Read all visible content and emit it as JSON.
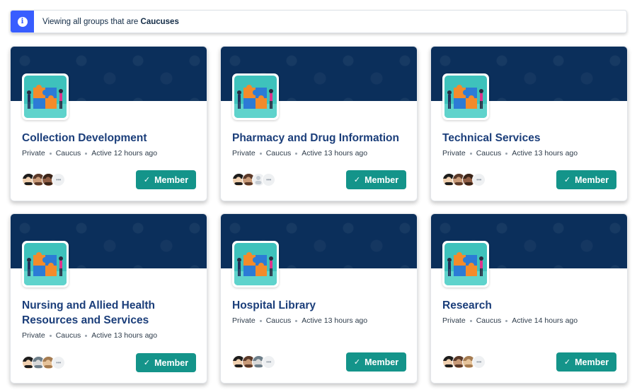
{
  "notice": {
    "prefix": "Viewing all groups that are ",
    "highlight": "Caucuses",
    "icon": "info-icon"
  },
  "colors": {
    "accent": "#385dff",
    "cover": "#0b2f5b",
    "member_button": "#14948a",
    "title": "#1b3e7a"
  },
  "groups": [
    {
      "title": "Collection Development",
      "privacy": "Private",
      "type": "Caucus",
      "activity": "Active 12 hours ago",
      "button": "Member"
    },
    {
      "title": "Pharmacy and Drug Information",
      "privacy": "Private",
      "type": "Caucus",
      "activity": "Active 13 hours ago",
      "button": "Member"
    },
    {
      "title": "Technical Services",
      "privacy": "Private",
      "type": "Caucus",
      "activity": "Active 13 hours ago",
      "button": "Member"
    },
    {
      "title": "Nursing and Allied Health Resources and Services",
      "privacy": "Private",
      "type": "Caucus",
      "activity": "Active 13 hours ago",
      "button": "Member"
    },
    {
      "title": "Hospital Library",
      "privacy": "Private",
      "type": "Caucus",
      "activity": "Active 13 hours ago",
      "button": "Member"
    },
    {
      "title": "Research",
      "privacy": "Private",
      "type": "Caucus",
      "activity": "Active 14 hours ago",
      "button": "Member"
    }
  ],
  "more_members_glyph": "•••",
  "check_glyph": "✓"
}
